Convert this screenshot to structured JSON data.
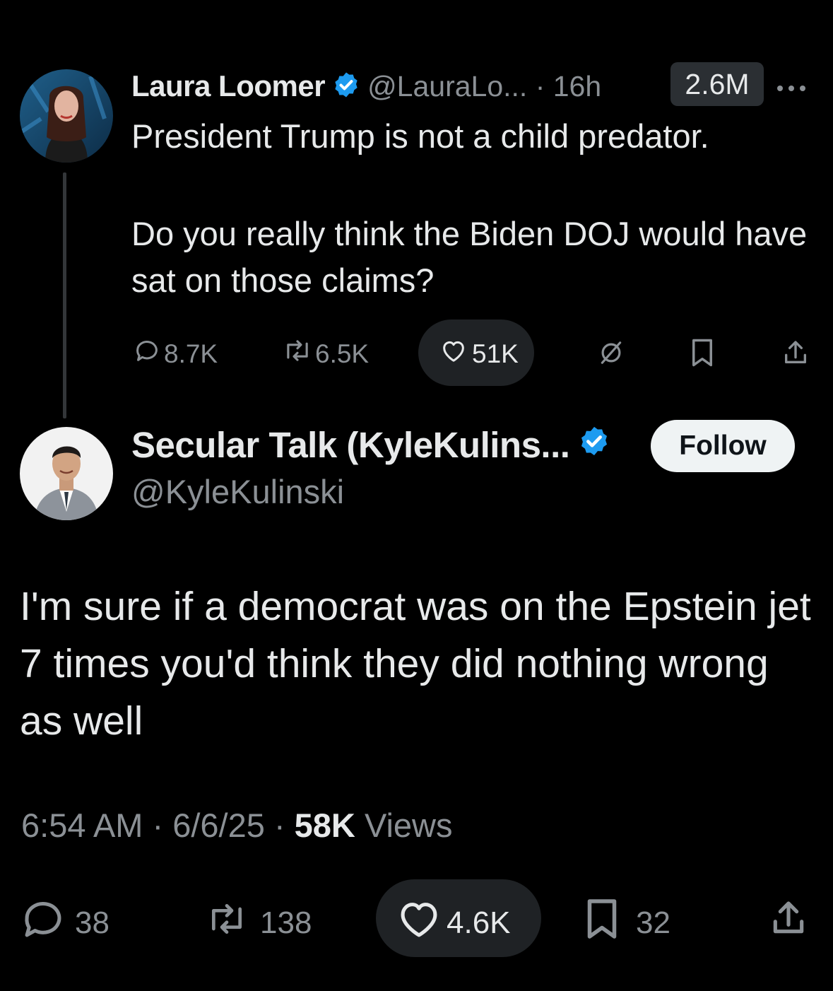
{
  "parent_tweet": {
    "author_name": "Laura Loomer",
    "handle_time": "@LauraLo... · 16h",
    "views": "2.6M",
    "paragraphs": [
      "President Trump is not a child predator.",
      "Do you really think the Biden DOJ would have sat on those claims?"
    ],
    "actions": {
      "replies": "8.7K",
      "reposts": "6.5K",
      "likes": "51K"
    }
  },
  "reply_tweet": {
    "author_name": "Secular Talk (KyleKulins...",
    "handle": "@KyleKulinski",
    "follow_label": "Follow",
    "text": "I'm sure if a democrat was on the Epstein jet 7 times you'd think they did nothing wrong as well",
    "meta_time": "6:54 AM · 6/6/25 · ",
    "meta_views_count": "58K",
    "meta_views_label": " Views",
    "actions": {
      "replies": "38",
      "reposts": "138",
      "likes": "4.6K",
      "bookmarks": "32"
    }
  },
  "colors": {
    "background": "#000000",
    "text": "#e7e9ea",
    "secondary": "#8b9095",
    "verified": "#1d9bf0",
    "pill": "#1f2225"
  },
  "icons": [
    "verified-badge-icon",
    "more-icon",
    "reply-icon",
    "repost-icon",
    "like-icon",
    "grok-icon",
    "bookmark-icon",
    "share-icon"
  ]
}
